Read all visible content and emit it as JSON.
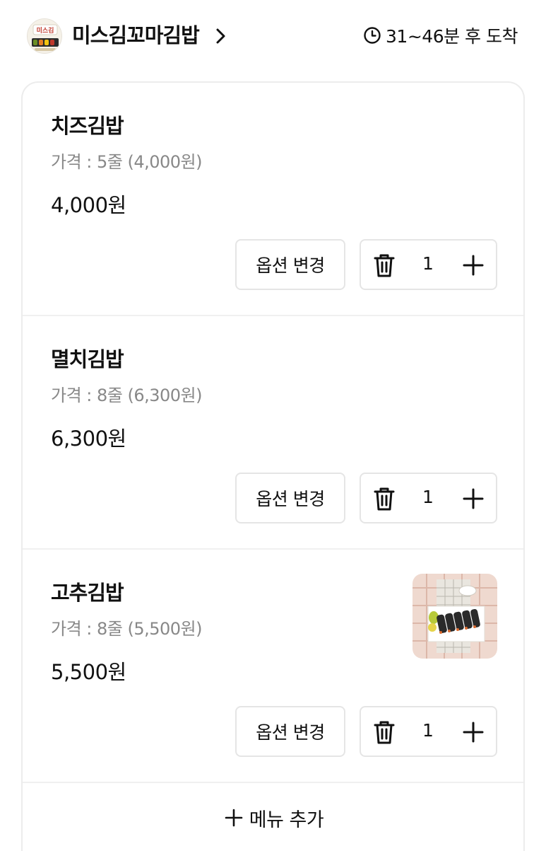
{
  "store": {
    "logo_text": "미스김",
    "name": "미스김꼬마김밥",
    "eta": "31~46분 후 도착"
  },
  "items": [
    {
      "name": "치즈김밥",
      "option": "가격 : 5줄 (4,000원)",
      "price": "4,000원",
      "quantity": "1",
      "option_button": "옵션 변경",
      "has_thumbnail": false
    },
    {
      "name": "멸치김밥",
      "option": "가격 : 8줄 (6,300원)",
      "price": "6,300원",
      "quantity": "1",
      "option_button": "옵션 변경",
      "has_thumbnail": false
    },
    {
      "name": "고추김밥",
      "option": "가격 : 8줄 (5,500원)",
      "price": "5,500원",
      "quantity": "1",
      "option_button": "옵션 변경",
      "has_thumbnail": true
    }
  ],
  "add_menu_label": "메뉴 추가",
  "icons": {
    "clock": "clock-icon",
    "chevron": "chevron-right-icon",
    "trash": "trash-icon",
    "plus": "plus-icon"
  },
  "colors": {
    "text": "#111111",
    "subtext": "#888888",
    "border": "#e5e5e5"
  }
}
